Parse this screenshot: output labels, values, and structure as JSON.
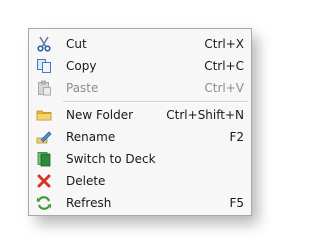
{
  "menu": {
    "items": [
      {
        "label": "Cut",
        "shortcut": "Ctrl+X",
        "icon": "scissors-icon",
        "enabled": true
      },
      {
        "label": "Copy",
        "shortcut": "Ctrl+C",
        "icon": "copy-icon",
        "enabled": true
      },
      {
        "label": "Paste",
        "shortcut": "Ctrl+V",
        "icon": "paste-icon",
        "enabled": false
      },
      {
        "label": "New Folder",
        "shortcut": "Ctrl+Shift+N",
        "icon": "folder-icon",
        "enabled": true
      },
      {
        "label": "Rename",
        "shortcut": "F2",
        "icon": "rename-icon",
        "enabled": true
      },
      {
        "label": "Switch to Deck",
        "shortcut": "",
        "icon": "deck-icon",
        "enabled": true
      },
      {
        "label": "Delete",
        "shortcut": "",
        "icon": "delete-icon",
        "enabled": true
      },
      {
        "label": "Refresh",
        "shortcut": "F5",
        "icon": "refresh-icon",
        "enabled": true
      }
    ]
  },
  "colors": {
    "menu_background": "#f7f7f7",
    "menu_border": "#a9a9a9",
    "disabled_text": "#8d8d8d",
    "delete_icon": "#d9342b",
    "refresh_icon": "#3f9c35",
    "deck_icon": "#2f8a3a",
    "folder_icon": "#f2c94c"
  }
}
